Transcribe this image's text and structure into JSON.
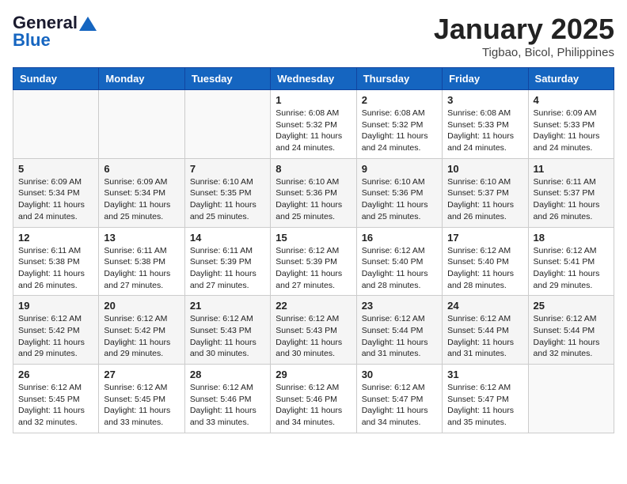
{
  "header": {
    "logo_general": "General",
    "logo_blue": "Blue",
    "month": "January 2025",
    "location": "Tigbao, Bicol, Philippines"
  },
  "days": [
    "Sunday",
    "Monday",
    "Tuesday",
    "Wednesday",
    "Thursday",
    "Friday",
    "Saturday"
  ],
  "weeks": [
    [
      {
        "day": "",
        "content": ""
      },
      {
        "day": "",
        "content": ""
      },
      {
        "day": "",
        "content": ""
      },
      {
        "day": "1",
        "content": "Sunrise: 6:08 AM\nSunset: 5:32 PM\nDaylight: 11 hours and 24 minutes."
      },
      {
        "day": "2",
        "content": "Sunrise: 6:08 AM\nSunset: 5:32 PM\nDaylight: 11 hours and 24 minutes."
      },
      {
        "day": "3",
        "content": "Sunrise: 6:08 AM\nSunset: 5:33 PM\nDaylight: 11 hours and 24 minutes."
      },
      {
        "day": "4",
        "content": "Sunrise: 6:09 AM\nSunset: 5:33 PM\nDaylight: 11 hours and 24 minutes."
      }
    ],
    [
      {
        "day": "5",
        "content": "Sunrise: 6:09 AM\nSunset: 5:34 PM\nDaylight: 11 hours and 24 minutes."
      },
      {
        "day": "6",
        "content": "Sunrise: 6:09 AM\nSunset: 5:34 PM\nDaylight: 11 hours and 25 minutes."
      },
      {
        "day": "7",
        "content": "Sunrise: 6:10 AM\nSunset: 5:35 PM\nDaylight: 11 hours and 25 minutes."
      },
      {
        "day": "8",
        "content": "Sunrise: 6:10 AM\nSunset: 5:36 PM\nDaylight: 11 hours and 25 minutes."
      },
      {
        "day": "9",
        "content": "Sunrise: 6:10 AM\nSunset: 5:36 PM\nDaylight: 11 hours and 25 minutes."
      },
      {
        "day": "10",
        "content": "Sunrise: 6:10 AM\nSunset: 5:37 PM\nDaylight: 11 hours and 26 minutes."
      },
      {
        "day": "11",
        "content": "Sunrise: 6:11 AM\nSunset: 5:37 PM\nDaylight: 11 hours and 26 minutes."
      }
    ],
    [
      {
        "day": "12",
        "content": "Sunrise: 6:11 AM\nSunset: 5:38 PM\nDaylight: 11 hours and 26 minutes."
      },
      {
        "day": "13",
        "content": "Sunrise: 6:11 AM\nSunset: 5:38 PM\nDaylight: 11 hours and 27 minutes."
      },
      {
        "day": "14",
        "content": "Sunrise: 6:11 AM\nSunset: 5:39 PM\nDaylight: 11 hours and 27 minutes."
      },
      {
        "day": "15",
        "content": "Sunrise: 6:12 AM\nSunset: 5:39 PM\nDaylight: 11 hours and 27 minutes."
      },
      {
        "day": "16",
        "content": "Sunrise: 6:12 AM\nSunset: 5:40 PM\nDaylight: 11 hours and 28 minutes."
      },
      {
        "day": "17",
        "content": "Sunrise: 6:12 AM\nSunset: 5:40 PM\nDaylight: 11 hours and 28 minutes."
      },
      {
        "day": "18",
        "content": "Sunrise: 6:12 AM\nSunset: 5:41 PM\nDaylight: 11 hours and 29 minutes."
      }
    ],
    [
      {
        "day": "19",
        "content": "Sunrise: 6:12 AM\nSunset: 5:42 PM\nDaylight: 11 hours and 29 minutes."
      },
      {
        "day": "20",
        "content": "Sunrise: 6:12 AM\nSunset: 5:42 PM\nDaylight: 11 hours and 29 minutes."
      },
      {
        "day": "21",
        "content": "Sunrise: 6:12 AM\nSunset: 5:43 PM\nDaylight: 11 hours and 30 minutes."
      },
      {
        "day": "22",
        "content": "Sunrise: 6:12 AM\nSunset: 5:43 PM\nDaylight: 11 hours and 30 minutes."
      },
      {
        "day": "23",
        "content": "Sunrise: 6:12 AM\nSunset: 5:44 PM\nDaylight: 11 hours and 31 minutes."
      },
      {
        "day": "24",
        "content": "Sunrise: 6:12 AM\nSunset: 5:44 PM\nDaylight: 11 hours and 31 minutes."
      },
      {
        "day": "25",
        "content": "Sunrise: 6:12 AM\nSunset: 5:44 PM\nDaylight: 11 hours and 32 minutes."
      }
    ],
    [
      {
        "day": "26",
        "content": "Sunrise: 6:12 AM\nSunset: 5:45 PM\nDaylight: 11 hours and 32 minutes."
      },
      {
        "day": "27",
        "content": "Sunrise: 6:12 AM\nSunset: 5:45 PM\nDaylight: 11 hours and 33 minutes."
      },
      {
        "day": "28",
        "content": "Sunrise: 6:12 AM\nSunset: 5:46 PM\nDaylight: 11 hours and 33 minutes."
      },
      {
        "day": "29",
        "content": "Sunrise: 6:12 AM\nSunset: 5:46 PM\nDaylight: 11 hours and 34 minutes."
      },
      {
        "day": "30",
        "content": "Sunrise: 6:12 AM\nSunset: 5:47 PM\nDaylight: 11 hours and 34 minutes."
      },
      {
        "day": "31",
        "content": "Sunrise: 6:12 AM\nSunset: 5:47 PM\nDaylight: 11 hours and 35 minutes."
      },
      {
        "day": "",
        "content": ""
      }
    ]
  ]
}
